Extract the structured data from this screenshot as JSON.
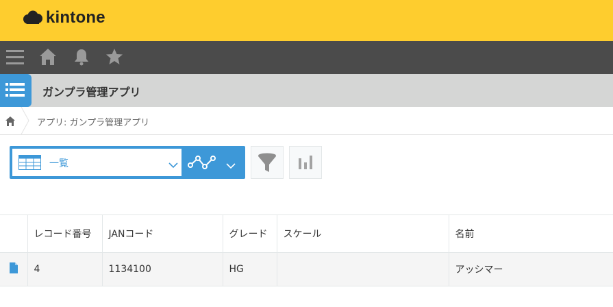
{
  "brand": {
    "name": "kintone"
  },
  "nav": {
    "icons": [
      "menu-icon",
      "home-icon",
      "bell-icon",
      "star-icon"
    ]
  },
  "app": {
    "title": "ガンプラ管理アプリ",
    "icon": "list-icon"
  },
  "breadcrumb": {
    "text": "アプリ: ガンプラ管理アプリ"
  },
  "toolbar": {
    "view_name": "一覧",
    "buttons": [
      "graph-icon",
      "filter-icon",
      "bar-chart-icon"
    ]
  },
  "table": {
    "columns": [
      "",
      "レコード番号",
      "JANコード",
      "グレード",
      "スケール",
      "名前"
    ],
    "rows": [
      {
        "record_no": "4",
        "jan": "1134100",
        "grade": "HG",
        "scale": "",
        "name": "アッシマー"
      }
    ]
  },
  "colors": {
    "brand_yellow": "#fecd2e",
    "nav_dark": "#4b4b4b",
    "accent_blue": "#3d98d8",
    "header_gray": "#d5d6d5"
  }
}
